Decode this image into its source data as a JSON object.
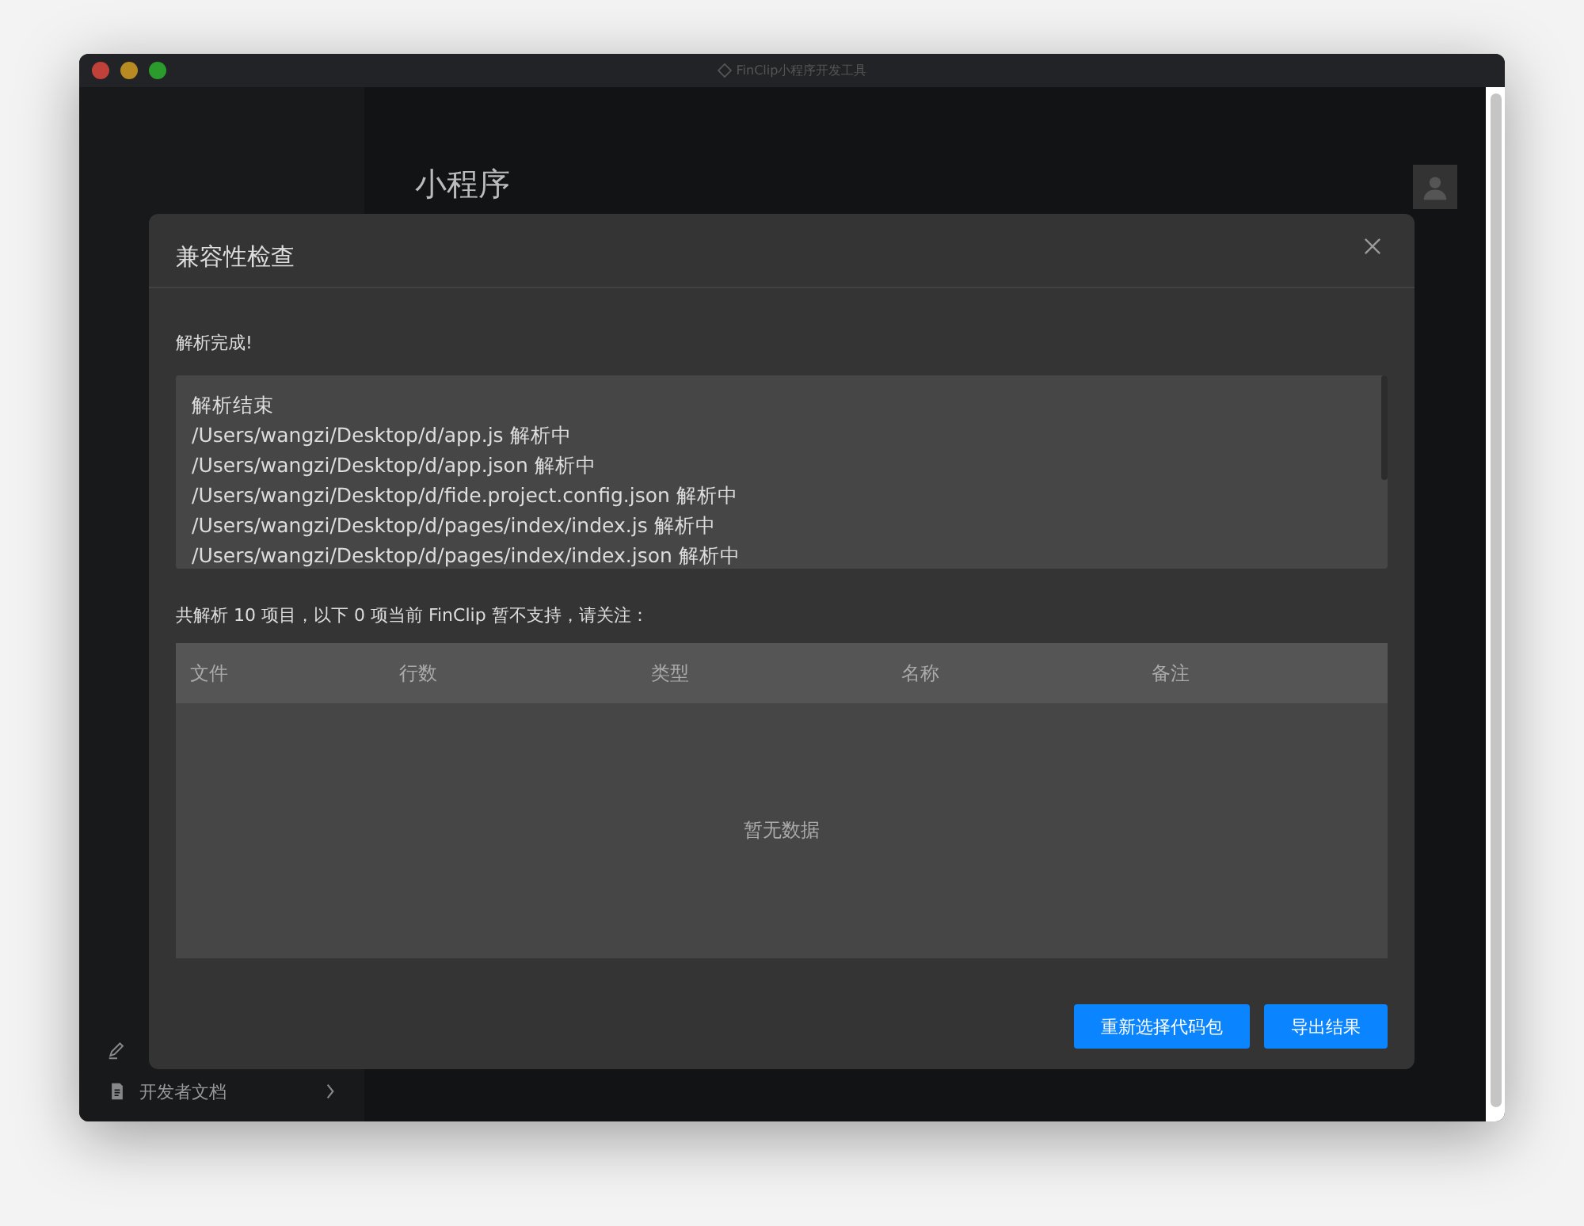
{
  "window": {
    "title": "FinClip小程序开发工具"
  },
  "sidebar": {
    "items": [
      {
        "kind": "edit"
      },
      {
        "kind": "doc",
        "label": "开发者文档"
      }
    ]
  },
  "main": {
    "heading": "小程序"
  },
  "dialog": {
    "title": "兼容性检查",
    "status": "解析完成!",
    "log": [
      "解析结束",
      "/Users/wangzi/Desktop/d/app.js 解析中",
      "/Users/wangzi/Desktop/d/app.json 解析中",
      "/Users/wangzi/Desktop/d/fide.project.config.json 解析中",
      "/Users/wangzi/Desktop/d/pages/index/index.js 解析中",
      "/Users/wangzi/Desktop/d/pages/index/index.json 解析中"
    ],
    "summary": "共解析 10 项目，以下 0 项当前 FinClip 暂不支持，请关注：",
    "table": {
      "columns": [
        "文件",
        "行数",
        "类型",
        "名称",
        "备注"
      ],
      "empty_text": "暂无数据"
    },
    "buttons": [
      "重新选择代码包",
      "导出结果"
    ]
  }
}
